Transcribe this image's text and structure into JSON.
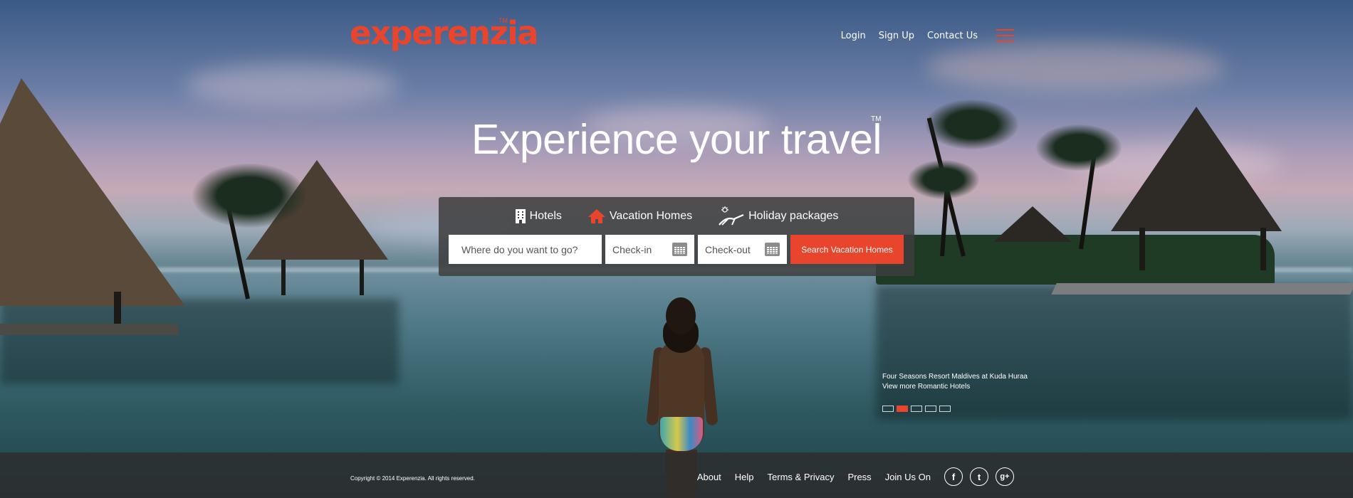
{
  "brand": {
    "name": "experenzia",
    "trademark": "TM",
    "color": "#e8452c"
  },
  "nav": {
    "login": "Login",
    "signup": "Sign Up",
    "contact": "Contact Us",
    "menu_icon": "hamburger-menu-icon"
  },
  "hero": {
    "headline": "Experience your travel",
    "trademark": "TM"
  },
  "search": {
    "tabs": [
      {
        "label": "Hotels",
        "icon": "building-icon"
      },
      {
        "label": "Vacation Homes",
        "icon": "house-icon",
        "active": true
      },
      {
        "label": "Holiday packages",
        "icon": "beach-chair-icon"
      }
    ],
    "destination_placeholder": "Where do you want to go?",
    "checkin_placeholder": "Check-in",
    "checkout_placeholder": "Check-out",
    "calendar_icon": "calendar-icon",
    "button_label": "Search Vacation Homes"
  },
  "slide": {
    "caption": "Four Seasons Resort Maldives at Kuda Huraa",
    "link": "View more Romantic Hotels",
    "count": 5,
    "active_index": 1
  },
  "footer": {
    "copyright": "Copyright © 2014 Experenzia. All rights reserved.",
    "links": [
      "About",
      "Help",
      "Terms & Privacy",
      "Press"
    ],
    "join_label": "Join Us On",
    "social": [
      {
        "icon": "facebook-icon",
        "glyph": "f"
      },
      {
        "icon": "twitter-icon",
        "glyph": "t"
      },
      {
        "icon": "google-plus-icon",
        "glyph": "g+"
      }
    ]
  }
}
